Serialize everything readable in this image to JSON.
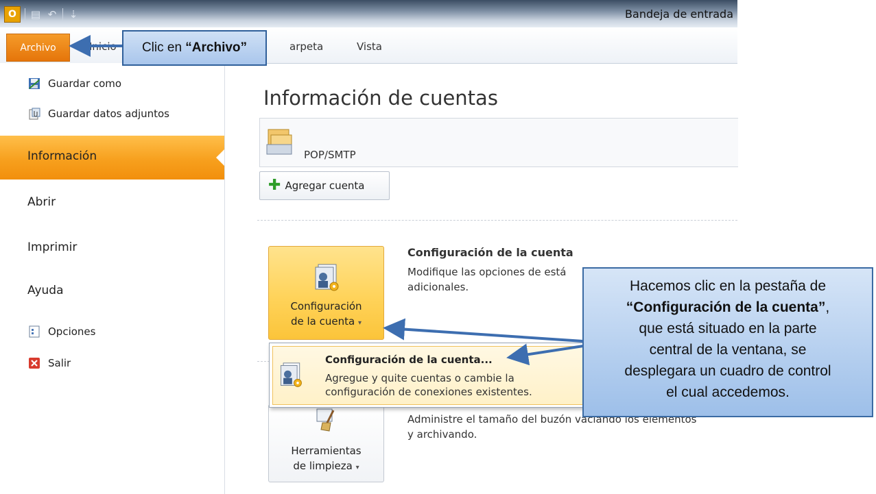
{
  "window": {
    "title": "Bandeja de entrada"
  },
  "tabs": {
    "archivo": "Archivo",
    "inicio": "Inicio",
    "carpeta": "arpeta",
    "vista": "Vista"
  },
  "nav": {
    "guardar_como": "Guardar como",
    "guardar_adjuntos": "Guardar datos adjuntos",
    "informacion": "Información",
    "abrir": "Abrir",
    "imprimir": "Imprimir",
    "ayuda": "Ayuda",
    "opciones": "Opciones",
    "salir": "Salir"
  },
  "main": {
    "title": "Información de cuentas",
    "account_type": "POP/SMTP",
    "add_account": "Agregar cuenta",
    "config_button_line1": "Configuración",
    "config_button_line2": "de la cuenta",
    "config_title": "Configuración de la cuenta",
    "config_desc_line1": "Modifique las opciones de está",
    "config_desc_line2": "adicionales.",
    "clean_button_line1": "Herramientas",
    "clean_button_line2": "de limpieza",
    "clean_desc_line1": "Administre el tamaño del buzón vaciando los elementos",
    "clean_desc_line2": "y archivando."
  },
  "dropdown": {
    "title": "Configuración de la cuenta...",
    "desc_line1": "Agregue y quite cuentas o cambie la",
    "desc_line2": "configuración de conexiones existentes."
  },
  "callouts": {
    "archivo_prefix": "Clic en ",
    "archivo_bold": "“Archivo”",
    "config_line1": "Hacemos clic en la pestaña de",
    "config_bold": "“Configuración de la cuenta”",
    "config_comma": ",",
    "config_line3": "que está situado en la parte",
    "config_line4": "central de la ventana, se",
    "config_line5": "desplegara un cuadro de control",
    "config_line6": "el cual accedemos."
  },
  "colors": {
    "accent_orange": "#f28f0c",
    "callout_blue": "#a9c6ec",
    "arrow_blue": "#3d6eb0"
  }
}
